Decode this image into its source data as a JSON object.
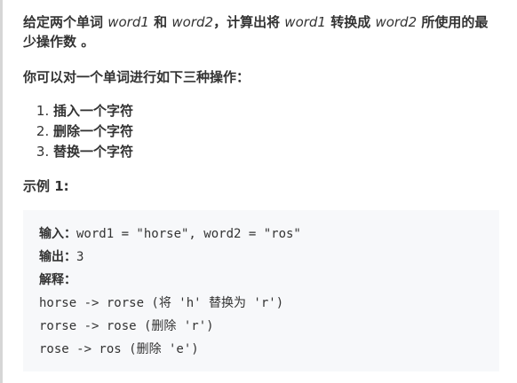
{
  "intro": {
    "t1": "给定两个单词 ",
    "word1": "word1",
    "t2": " 和 ",
    "word2": "word2",
    "t3": "，计算出将 ",
    "word1b": "word1",
    "t4": " 转换成 ",
    "word2b": "word2",
    "t5": " 所使用的最少操作数 。"
  },
  "ops_intro": "你可以对一个单词进行如下三种操作：",
  "operations": [
    "插入一个字符",
    "删除一个字符",
    "替换一个字符"
  ],
  "example": {
    "title": "示例 1:",
    "input_label": "输入：",
    "input_value": "word1 = \"horse\", word2 = \"ros\"",
    "output_label": "输出：",
    "output_value": "3",
    "explain_label": "解释：",
    "steps": [
      "horse -> rorse (将 'h' 替换为 'r')",
      "rorse -> rose (删除 'r')",
      "rose -> ros (删除 'e')"
    ]
  }
}
